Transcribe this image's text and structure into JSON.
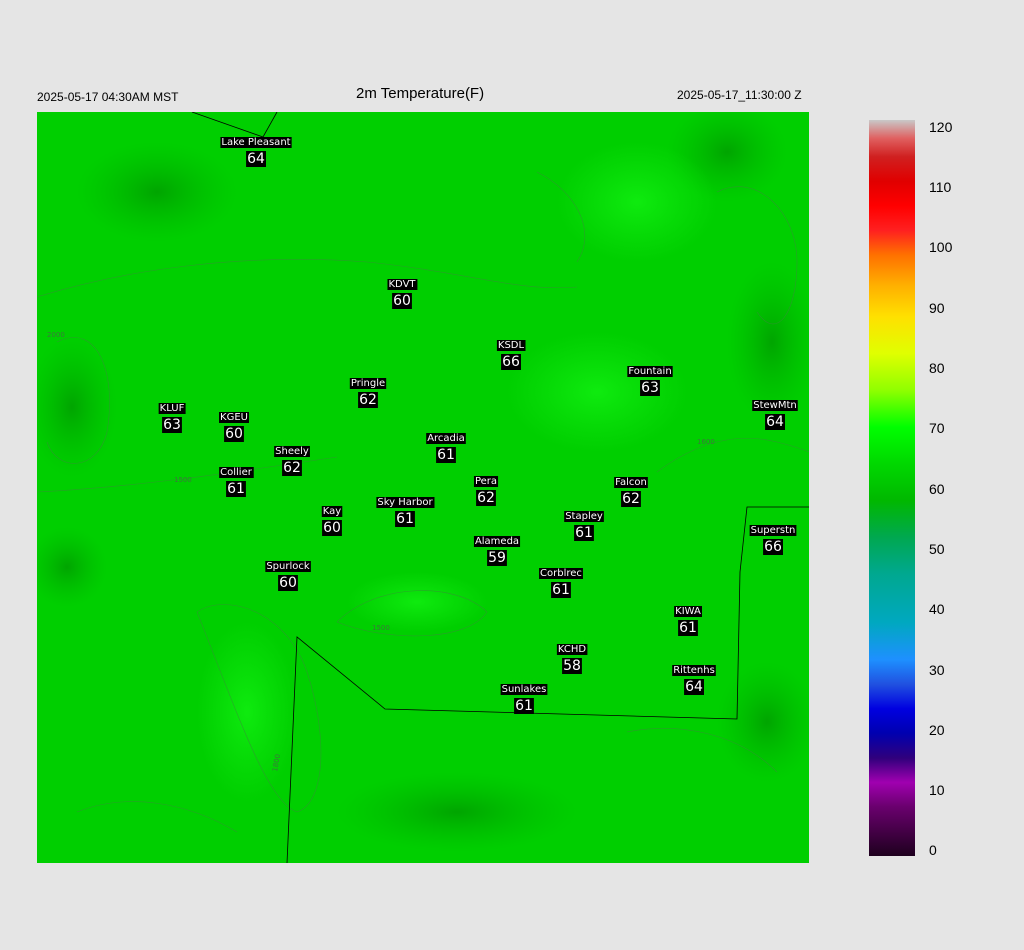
{
  "header": {
    "local_time": "2025-05-17 04:30AM MST",
    "title": "2m Temperature(F)",
    "utc_time": "2025-05-17_11:30:00 Z"
  },
  "colors": {
    "background": "#e5e5e5",
    "field": "#00cf00"
  },
  "stations": [
    {
      "name": "Lake Pleasant",
      "value": "64"
    },
    {
      "name": "KDVT",
      "value": "60"
    },
    {
      "name": "KSDL",
      "value": "66"
    },
    {
      "name": "Fountain",
      "value": "63"
    },
    {
      "name": "Pringle",
      "value": "62"
    },
    {
      "name": "KLUF",
      "value": "63"
    },
    {
      "name": "KGEU",
      "value": "60"
    },
    {
      "name": "StewMtn",
      "value": "64"
    },
    {
      "name": "Arcadia",
      "value": "61"
    },
    {
      "name": "Sheely",
      "value": "62"
    },
    {
      "name": "Collier",
      "value": "61"
    },
    {
      "name": "Pera",
      "value": "62"
    },
    {
      "name": "Falcon",
      "value": "62"
    },
    {
      "name": "Sky Harbor",
      "value": "61"
    },
    {
      "name": "Kay",
      "value": "60"
    },
    {
      "name": "Stapley",
      "value": "61"
    },
    {
      "name": "Superstn",
      "value": "66"
    },
    {
      "name": "Alameda",
      "value": "59"
    },
    {
      "name": "Spurlock",
      "value": "60"
    },
    {
      "name": "Corblrec",
      "value": "61"
    },
    {
      "name": "KIWA",
      "value": "61"
    },
    {
      "name": "KCHD",
      "value": "58"
    },
    {
      "name": "Rittenhs",
      "value": "64"
    },
    {
      "name": "Sunlakes",
      "value": "61"
    }
  ],
  "contour_labels": [
    "1600",
    "1500",
    "1500",
    "1800",
    "2000"
  ],
  "colorbar": {
    "labels": [
      "120",
      "110",
      "100",
      "90",
      "80",
      "70",
      "60",
      "50",
      "40",
      "30",
      "20",
      "10",
      "0"
    ]
  }
}
